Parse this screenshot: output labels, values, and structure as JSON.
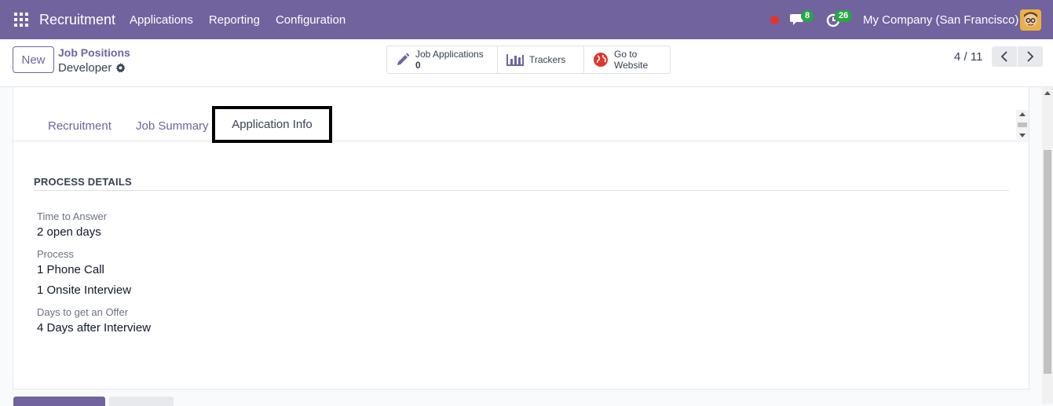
{
  "navbar": {
    "app_name": "Recruitment",
    "menu": [
      "Applications",
      "Reporting",
      "Configuration"
    ],
    "messages_count": "8",
    "activities_count": "26",
    "company": "My Company (San Francisco)"
  },
  "control": {
    "new_label": "New",
    "breadcrumb_parent": "Job Positions",
    "breadcrumb_current": "Developer",
    "smart_buttons": {
      "applications_label": "Job Applications",
      "applications_value": "0",
      "trackers_label": "Trackers",
      "website_label_1": "Go to",
      "website_label_2": "Website"
    },
    "pager": "4 / 11"
  },
  "tabs": {
    "recruitment": "Recruitment",
    "job_summary": "Job Summary",
    "application_info": "Application Info"
  },
  "process": {
    "section_title": "PROCESS DETAILS",
    "time_to_answer_label": "Time to Answer",
    "time_to_answer_value": "2 open days",
    "process_label": "Process",
    "process_step_1": "1 Phone Call",
    "process_step_2": "1 Onsite Interview",
    "days_offer_label": "Days to get an Offer",
    "days_offer_value": "4 Days after Interview"
  },
  "colors": {
    "brand": "#71639e",
    "badge": "#28a745",
    "status": "#e0372c"
  }
}
